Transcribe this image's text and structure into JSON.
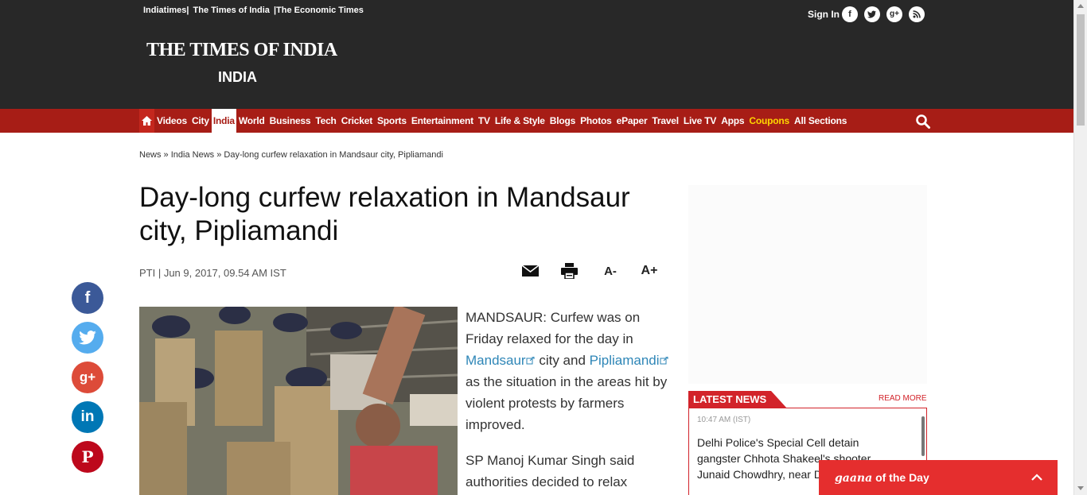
{
  "header": {
    "top_links": [
      "Indiatimes|",
      "The Times of India",
      "|The Economic Times"
    ],
    "logo": "THE TIMES OF INDIA",
    "section": "INDIA",
    "sign_in": "Sign In",
    "social": [
      "f",
      "t",
      "g+",
      "rss"
    ]
  },
  "nav": {
    "items": [
      "Videos",
      "City",
      "India",
      "World",
      "Business",
      "Tech",
      "Cricket",
      "Sports",
      "Entertainment",
      "TV",
      "Life & Style",
      "Blogs",
      "Photos",
      "ePaper",
      "Travel",
      "Live TV",
      "Apps",
      "Coupons",
      "All Sections"
    ],
    "active": "India",
    "highlight": "Coupons"
  },
  "breadcrumb": "News » India News » Day-long curfew relaxation in Mandsaur city, Pipliamandi",
  "article": {
    "headline": "Day-long curfew relaxation in Mandsaur city, Pipliamandi",
    "byline": "PTI | Jun 9, 2017, 09.54 AM IST",
    "tools": {
      "font_down": "A-",
      "font_up": "A+"
    },
    "para1_a": "MANDSAUR: Curfew was on Friday relaxed for the day in ",
    "para1_link1": "Mandsaur",
    "para1_b": " city and ",
    "para1_link2": "Pipliamandi",
    "para1_c": " as the situation in the areas hit by violent protests by farmers improved.",
    "para2": "SP Manoj Kumar Singh said authorities decided to relax"
  },
  "share": {
    "facebook": "f",
    "twitter": "t",
    "google": "g+",
    "linkedin": "in",
    "pinterest": "P"
  },
  "sidebar": {
    "latest_title": "LATEST NEWS",
    "read_more": "READ MORE",
    "time": "10:47 AM (IST)",
    "headline": "Delhi Police's Special Cell detain gangster Chhota Shakeel's shooter Junaid Chowdhry, near Delhi: ANI"
  },
  "gaana": {
    "brand": "gaana",
    "label": " of the Day"
  },
  "colors": {
    "header_bg": "#282828",
    "nav_bg": "#a71d16",
    "accent": "#d2232a",
    "link": "#2e86b7",
    "coupon": "#ffd600",
    "facebook": "#3b5998",
    "twitter": "#55acee",
    "google": "#dd4b39",
    "linkedin": "#0077b5",
    "pinterest": "#bd081c"
  }
}
